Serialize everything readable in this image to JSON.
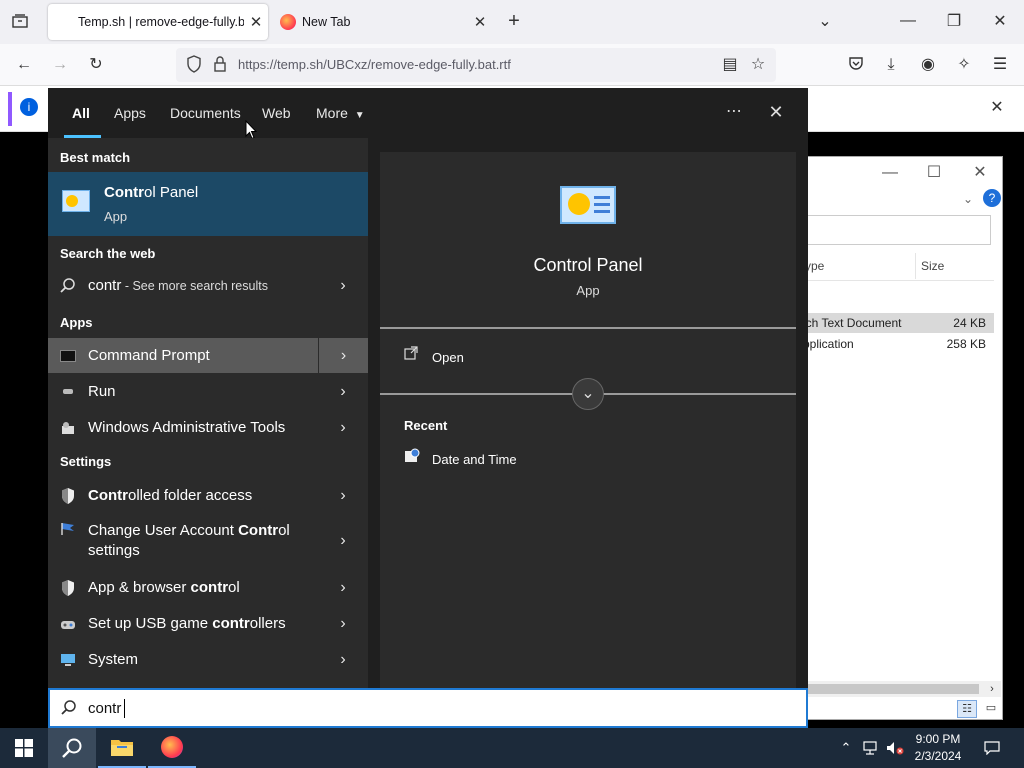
{
  "browser": {
    "tabs": [
      {
        "title": "Temp.sh | remove-edge-fully.ba",
        "active": true
      },
      {
        "title": "New Tab",
        "active": false
      }
    ],
    "url": "https://temp.sh/UBCxz/remove-edge-fully.bat.rtf"
  },
  "explorer": {
    "column_type": "ype",
    "column_size": "Size",
    "rows": [
      {
        "type": "ich Text Document",
        "size": "24 KB"
      },
      {
        "type": "pplication",
        "size": "258 KB"
      }
    ]
  },
  "search": {
    "tabs": [
      "All",
      "Apps",
      "Documents",
      "Web",
      "More"
    ],
    "query": "contr",
    "sections": {
      "best_match": "Best match",
      "search_web": "Search the web",
      "apps": "Apps",
      "settings": "Settings"
    },
    "best_match": {
      "name_bold": "Contr",
      "name_rest": "ol Panel",
      "type": "App"
    },
    "web_result": {
      "query": "contr",
      "suffix": " - See more search results"
    },
    "apps": [
      {
        "label": "Command Prompt",
        "icon": "cmd-icon"
      },
      {
        "label": "Run",
        "icon": "run-icon"
      },
      {
        "label": "Windows Administrative Tools",
        "icon": "admin-tools-icon"
      }
    ],
    "settings": [
      {
        "pre": "",
        "bold": "Contr",
        "post": "olled folder access",
        "icon": "shield-icon"
      },
      {
        "pre": "Change User Account ",
        "bold": "Contr",
        "post": "ol settings",
        "icon": "uac-flag-icon"
      },
      {
        "pre": "App & browser ",
        "bold": "contr",
        "post": "ol",
        "icon": "shield-icon"
      },
      {
        "pre": "Set up USB game ",
        "bold": "contr",
        "post": "ollers",
        "icon": "gamepad-icon"
      },
      {
        "pre": "System",
        "bold": "",
        "post": "",
        "icon": "monitor-icon"
      }
    ],
    "preview": {
      "title": "Control Panel",
      "type": "App",
      "open_label": "Open",
      "recent_header": "Recent",
      "recent_items": [
        "Date and Time"
      ]
    }
  },
  "taskbar": {
    "time": "9:00 PM",
    "date": "2/3/2024"
  }
}
